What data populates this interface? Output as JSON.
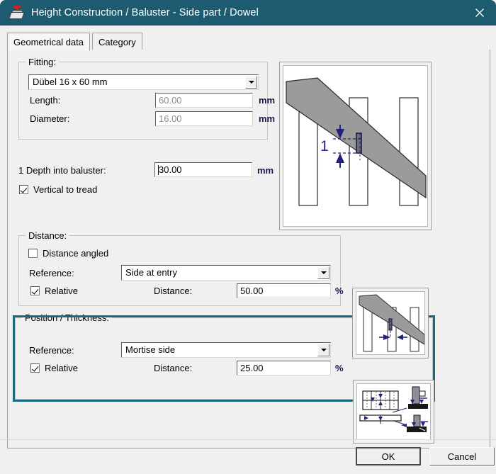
{
  "window": {
    "title": "Height Construction / Baluster - Side part / Dowel",
    "app_icon": "hand-plane-icon",
    "close_icon": "close-icon",
    "titlebar_color": "#1d5c70"
  },
  "tabs": [
    {
      "label": "Geometrical data",
      "active": true
    },
    {
      "label": "Category",
      "active": false
    }
  ],
  "fitting": {
    "group_title": "Fitting:",
    "fitting_combo": {
      "value": "Dübel 16 x 60 mm",
      "dropdown_icon": "chevron-down-icon"
    },
    "length_label": "Length:",
    "length_value": "60.00",
    "length_unit": "mm",
    "diameter_label": "Diameter:",
    "diameter_value": "16.00",
    "diameter_unit": "mm"
  },
  "depth": {
    "label": "1 Depth into baluster:",
    "value": "30.00",
    "unit": "mm"
  },
  "vertical_to_tread": {
    "label": "Vertical to tread",
    "checked": true
  },
  "distance_group": {
    "group_title": "Distance:",
    "distance_angled": {
      "label": "Distance angled",
      "checked": false
    },
    "reference_label": "Reference:",
    "reference_value": "Side at entry",
    "relative_label": "Relative",
    "relative_checked": true,
    "distance_label": "Distance:",
    "distance_value": "50.00",
    "distance_unit": "%"
  },
  "position_group": {
    "group_title": "Position / Thickness:",
    "highlight_color": "#1d6a80",
    "reference_label": "Reference:",
    "reference_value": "Mortise side",
    "relative_label": "Relative",
    "relative_checked": true,
    "distance_label": "Distance:",
    "distance_value": "25.00",
    "distance_unit": "%"
  },
  "previews": {
    "main": "stair-handrail-baluster-dowel-depth-diagram",
    "distance": "stair-handrail-baluster-distance-diagram",
    "position": "technical-drawing-position-thickness-diagram",
    "main_dimension_label": "1"
  },
  "buttons": {
    "ok": "OK",
    "cancel": "Cancel"
  }
}
